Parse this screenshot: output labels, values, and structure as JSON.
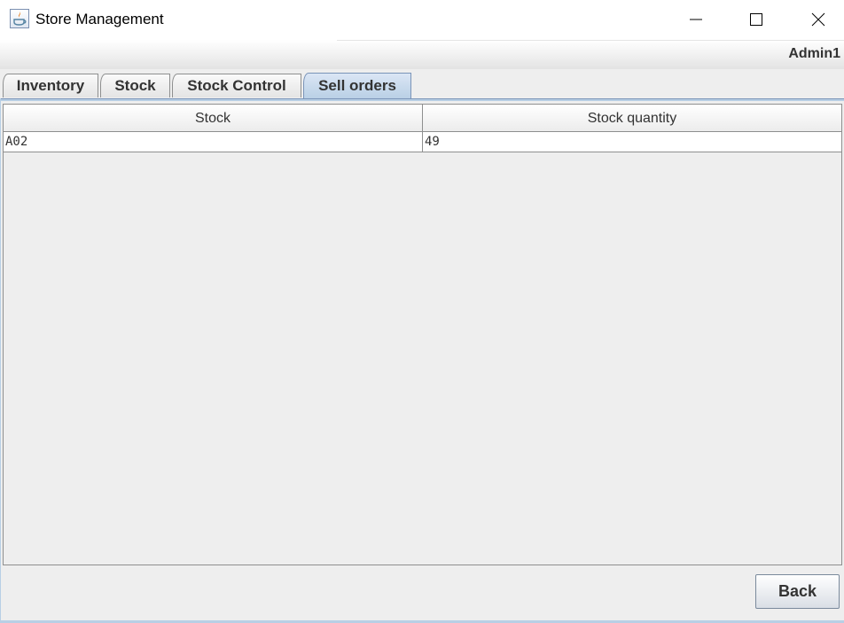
{
  "window": {
    "title": "Store Management",
    "controls": {
      "minimize": "minimize-icon",
      "maximize": "maximize-icon",
      "close": "close-icon"
    }
  },
  "header": {
    "user": "Admin1"
  },
  "tabs": [
    {
      "label": "Inventory",
      "active": false
    },
    {
      "label": "Stock",
      "active": false
    },
    {
      "label": "Stock Control",
      "active": false
    },
    {
      "label": "Sell orders",
      "active": true
    }
  ],
  "table": {
    "columns": [
      "Stock",
      "Stock quantity"
    ],
    "rows": [
      [
        "A02",
        "49"
      ]
    ]
  },
  "footer": {
    "back_label": "Back"
  },
  "colors": {
    "active_tab": "#b8cfe5",
    "background": "#eeeeee",
    "border": "#8e8f8f"
  }
}
